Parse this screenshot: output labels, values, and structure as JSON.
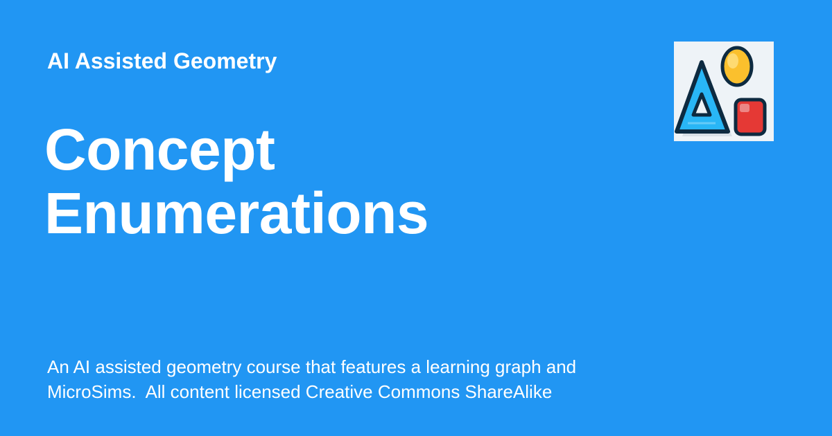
{
  "site": {
    "name": "AI Assisted Geometry"
  },
  "page": {
    "title_lines": [
      "Concept",
      "Enumerations"
    ],
    "description_lines": [
      "An AI assisted geometry course that features a learning graph and",
      "MicroSims.  All content licensed Creative Commons ShareAlike"
    ]
  },
  "logo": {
    "icon": "geometry-shapes-icon"
  },
  "colors": {
    "background": "#2196F3",
    "text": "#ffffff",
    "logo_background": "#eef3f7",
    "triangle": "#29b6f6",
    "circle": "#fbc02d",
    "square": "#e53935"
  }
}
